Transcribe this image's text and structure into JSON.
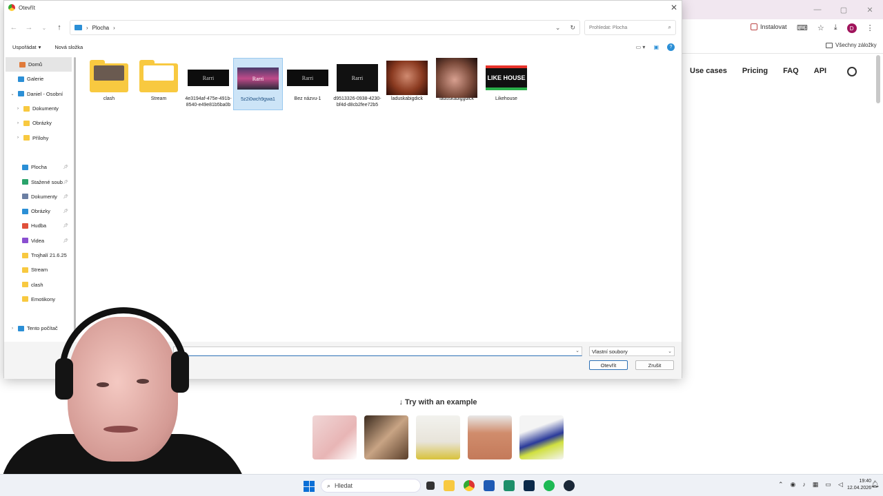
{
  "browser": {
    "install_label": "Instalovat",
    "bookmarks_all": "Všechny záložky",
    "avatar_letter": "D",
    "nav": [
      "Use cases",
      "Pricing",
      "FAQ",
      "API"
    ],
    "try_example": "↓ Try with an example"
  },
  "dialog": {
    "title": "Otevřít",
    "path_location": "Plocha",
    "search_placeholder": "Prohledat: Plocha",
    "organize_label": "Uspořádat",
    "new_folder_label": "Nová složka",
    "sidebar": [
      {
        "label": "Domů",
        "selected": true,
        "color": "#e07a3a"
      },
      {
        "label": "Galerie",
        "color": "#2b8fd6"
      },
      {
        "label": "Daniel - Osobní",
        "color": "#2b8fd6",
        "expanded": true
      },
      {
        "label": "Dokumenty",
        "color": "#f8c940",
        "child": true
      },
      {
        "label": "Obrázky",
        "color": "#f8c940",
        "child": true
      },
      {
        "label": "Přílohy",
        "color": "#f8c940",
        "child": true
      },
      {
        "label": "",
        "spacer": true
      },
      {
        "label": "Plocha",
        "color": "#2b8fd6",
        "pinned": true
      },
      {
        "label": "Stažené soub",
        "color": "#2aa36b",
        "pinned": true
      },
      {
        "label": "Dokumenty",
        "color": "#6b7fa3",
        "pinned": true
      },
      {
        "label": "Obrázky",
        "color": "#2b8fd6",
        "pinned": true
      },
      {
        "label": "Hudba",
        "color": "#e0503a",
        "pinned": true
      },
      {
        "label": "Videa",
        "color": "#8a4fd0",
        "pinned": true
      },
      {
        "label": "Trojhalí 21.6.25",
        "color": "#f8c940"
      },
      {
        "label": "Stream",
        "color": "#f8c940"
      },
      {
        "label": "clash",
        "color": "#f8c940"
      },
      {
        "label": "Emotikony",
        "color": "#f8c940"
      },
      {
        "label": "",
        "spacer": true
      },
      {
        "label": "Tento počítač",
        "color": "#2b8fd6",
        "collapsed": true
      }
    ],
    "files": [
      {
        "name": "clash",
        "kind": "folder",
        "inner": "#6a5a50"
      },
      {
        "name": "Stream",
        "kind": "folder",
        "inner": "#ffffff"
      },
      {
        "name": "4e3194af-475e-491b-8540-e49e81b5ba0b",
        "kind": "black",
        "text": "Rarri"
      },
      {
        "name": "5z2i0wch9gwa1",
        "kind": "photo",
        "selected": true,
        "text": "Rarri"
      },
      {
        "name": "Bez názvu-1",
        "kind": "black",
        "text": "Rarri"
      },
      {
        "name": "d9513326-0938-4230-bf4d-d8cb2fee72b5",
        "kind": "tall",
        "text": "Rarri"
      },
      {
        "name": "laduskabigdick",
        "kind": "face1"
      },
      {
        "name": "laduskabiggdick",
        "kind": "face2"
      },
      {
        "name": "Likehouse",
        "kind": "logo"
      }
    ],
    "filename_value": "",
    "filetype_value": "Vlastní soubory",
    "open_button": "Otevřít",
    "cancel_button": "Zrušit"
  },
  "taskbar": {
    "search_placeholder": "Hledat",
    "time": "19:40",
    "date": "12.04.2026"
  }
}
